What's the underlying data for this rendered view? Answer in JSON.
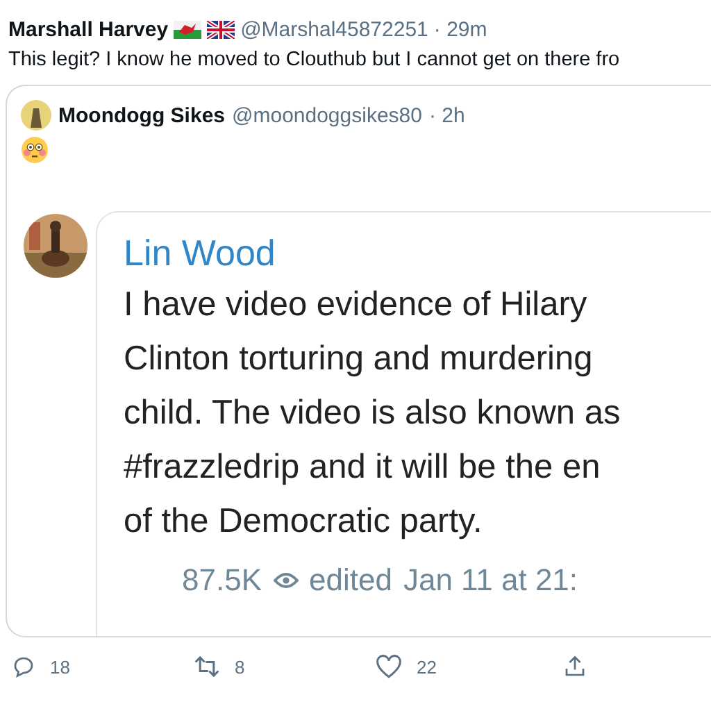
{
  "tweet": {
    "name": "Marshall Harvey",
    "handle": "@Marshal45872251",
    "time": "· 29m",
    "text": "This legit? I know he moved to Clouthub but I cannot get on there fro"
  },
  "quote": {
    "name": "Moondogg Sikes",
    "handle": "@moondoggsikes80",
    "time": "· 2h",
    "screenshot": {
      "author": "Lin Wood",
      "lines": [
        "I have video evidence of Hilary",
        "Clinton torturing and murdering",
        "child. The video is also known as",
        "#frazzledrip and it will be the en",
        "of the Democratic party."
      ],
      "views": "87.5K",
      "edited": "edited",
      "date": "Jan 11 at 21:"
    }
  },
  "actions": [
    {
      "kind": "reply",
      "count": "18"
    },
    {
      "kind": "retweet",
      "count": "8"
    },
    {
      "kind": "like",
      "count": "22"
    },
    {
      "kind": "share"
    }
  ]
}
